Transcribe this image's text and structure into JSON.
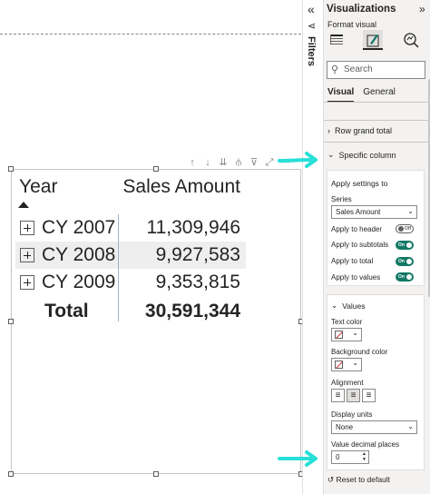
{
  "canvas": {
    "toolbar_icons": [
      "↑",
      "↓",
      "⇊",
      "⫛",
      "⊽",
      "⤢",
      "···"
    ]
  },
  "matrix": {
    "col_year": "Year",
    "col_sales": "Sales Amount",
    "rows": [
      {
        "year": "CY 2007",
        "sales": "11,309,946"
      },
      {
        "year": "CY 2008",
        "sales": "9,927,583"
      },
      {
        "year": "CY 2009",
        "sales": "9,353,815"
      }
    ],
    "total_label": "Total",
    "total_value": "30,591,344"
  },
  "filters": {
    "label": "Filters",
    "collapse_glyph": "«",
    "icon_glyph": "⋖"
  },
  "viz": {
    "title": "Visualizations",
    "collapse_glyph": "»",
    "subtitle": "Format visual",
    "search_placeholder": "Search",
    "tabs": [
      "Visual",
      "General"
    ],
    "section_row_grand_total": "Row grand total",
    "section_specific_column": "Specific column",
    "apply_settings_to": "Apply settings to",
    "series_label": "Series",
    "series_value": "Sales Amount",
    "apply_to_header": "Apply to header",
    "apply_to_subtotals": "Apply to subtotals",
    "apply_to_total": "Apply to total",
    "apply_to_values": "Apply to values",
    "toggle_on": "On",
    "toggle_off": "Off",
    "values_section": "Values",
    "text_color": "Text color",
    "background_color": "Background color",
    "alignment": "Alignment",
    "display_units": "Display units",
    "display_units_value": "None",
    "value_decimal_places": "Value decimal places",
    "decimal_value": "0",
    "reset": "Reset to default"
  },
  "colors": {
    "accent_arrow": "#28e0d8",
    "toggle_on": "#117865",
    "column_divider": "#9ab6d4"
  }
}
